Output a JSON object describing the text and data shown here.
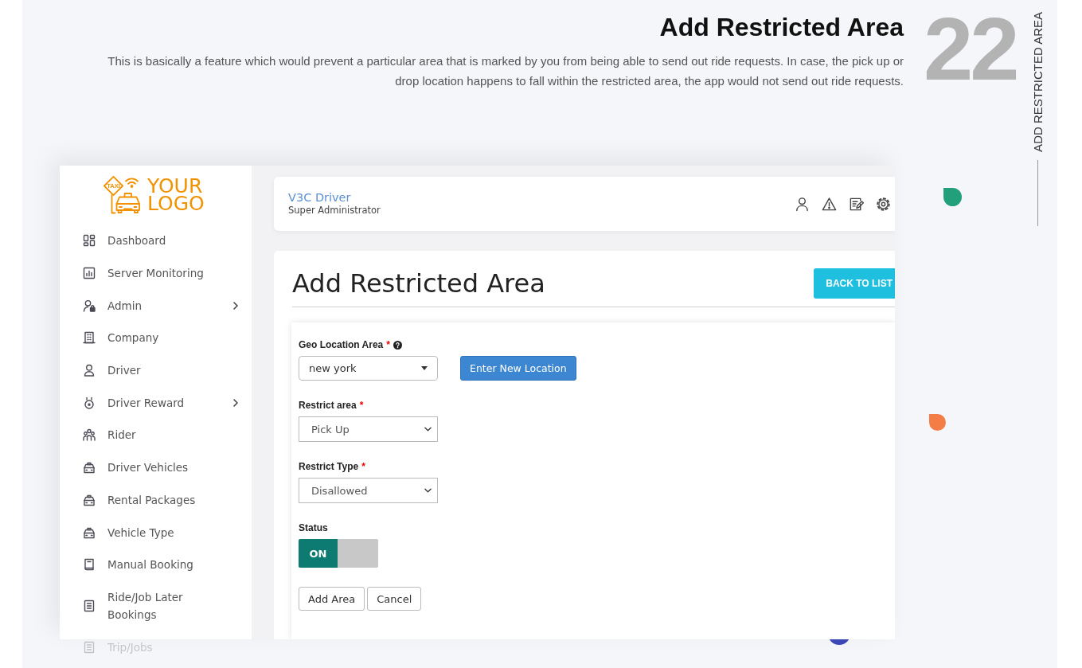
{
  "header": {
    "title": "Add Restricted Area",
    "description": "This is basically a feature which would prevent a particular area that is marked by you from being able to send out ride requests. In case, the pick up or drop location happens to fall within the restricted area, the app would not send out ride requests.",
    "number": "22",
    "side_label": "ADD RESTRICTED AREA"
  },
  "sidebar": {
    "logo": {
      "sign_text": "TAXI",
      "text": "YOUR LOGO"
    },
    "items": [
      {
        "label": "Dashboard",
        "submenu": false,
        "faded": false
      },
      {
        "label": "Server Monitoring",
        "submenu": false,
        "faded": false
      },
      {
        "label": "Admin",
        "submenu": true,
        "faded": false
      },
      {
        "label": "Company",
        "submenu": false,
        "faded": false
      },
      {
        "label": "Driver",
        "submenu": false,
        "faded": false
      },
      {
        "label": "Driver Reward",
        "submenu": true,
        "faded": false
      },
      {
        "label": "Rider",
        "submenu": false,
        "faded": false
      },
      {
        "label": "Driver Vehicles",
        "submenu": false,
        "faded": false
      },
      {
        "label": "Rental Packages",
        "submenu": false,
        "faded": false
      },
      {
        "label": "Vehicle Type",
        "submenu": false,
        "faded": false
      },
      {
        "label": "Manual Booking",
        "submenu": false,
        "faded": false
      },
      {
        "label": "Ride/Job Later Bookings",
        "submenu": false,
        "faded": false
      },
      {
        "label": "Trip/Jobs",
        "submenu": false,
        "faded": true
      }
    ]
  },
  "topbar": {
    "name": "V3C Driver",
    "role": "Super Administrator"
  },
  "main": {
    "title": "Add Restricted Area",
    "back_button": "BACK TO LIST",
    "form": {
      "fields": [
        {
          "kind": "combobox",
          "label": "Geo Location Area",
          "required_mark": "*",
          "help": true,
          "value": "new york",
          "action": "Enter New Location"
        },
        {
          "kind": "select",
          "label": "Restrict area",
          "required_mark": "*",
          "help": false,
          "value": "Pick Up"
        },
        {
          "kind": "select",
          "label": "Restrict Type",
          "required_mark": "*",
          "help": false,
          "value": "Disallowed"
        },
        {
          "kind": "toggle",
          "label": "Status",
          "help": false,
          "on": true,
          "text": "ON"
        }
      ],
      "buttons": [
        "Add Area",
        "Cancel"
      ]
    }
  }
}
